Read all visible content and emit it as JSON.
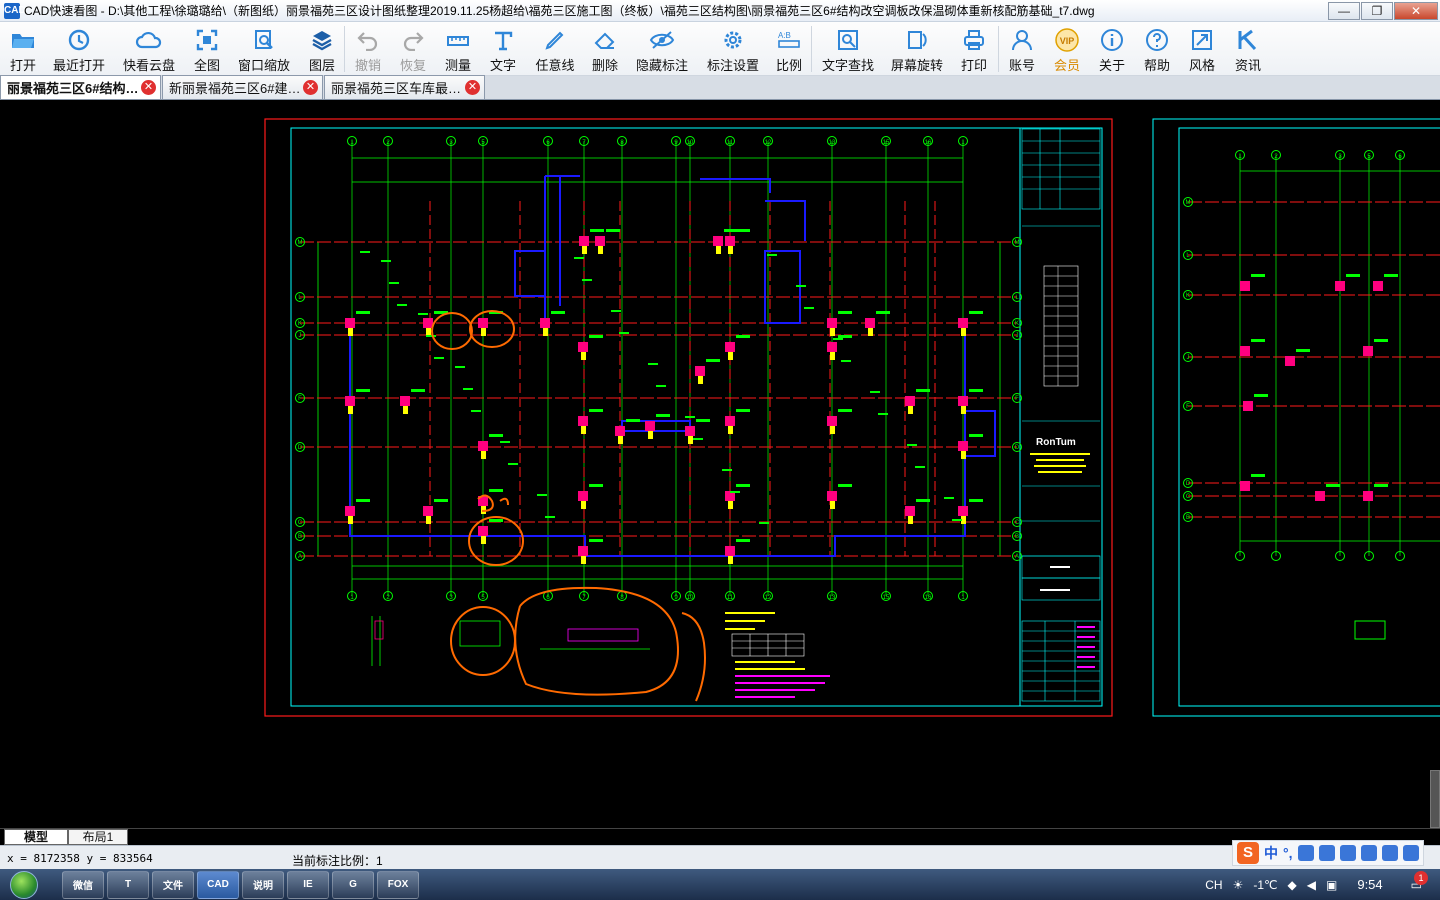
{
  "window": {
    "title": "CAD快速看图 - D:\\其他工程\\徐璐璐给\\（新图纸）丽景福苑三区设计图纸整理2019.11.25杨超给\\福苑三区施工图（终板）\\福苑三区结构图\\丽景福苑三区6#结构改空调板改保温砌体重新核配筋基础_t7.dwg",
    "app_icon": "CAD",
    "minimize": "—",
    "maximize": "❐",
    "close": "✕"
  },
  "toolbar": {
    "items": [
      {
        "label": "打开",
        "icon": "folder-open-icon",
        "enabled": true
      },
      {
        "label": "最近打开",
        "icon": "history-icon",
        "enabled": true
      },
      {
        "label": "快看云盘",
        "icon": "cloud-icon",
        "enabled": true
      },
      {
        "label": "全图",
        "icon": "fit-all-icon",
        "enabled": true
      },
      {
        "label": "窗口缩放",
        "icon": "window-zoom-icon",
        "enabled": true
      },
      {
        "label": "图层",
        "icon": "layers-icon",
        "enabled": true
      },
      {
        "label": "撤销",
        "icon": "undo-icon",
        "enabled": false
      },
      {
        "label": "恢复",
        "icon": "redo-icon",
        "enabled": false
      },
      {
        "label": "测量",
        "icon": "measure-icon",
        "enabled": true
      },
      {
        "label": "文字",
        "icon": "text-icon",
        "enabled": true
      },
      {
        "label": "任意线",
        "icon": "pen-icon",
        "enabled": true
      },
      {
        "label": "删除",
        "icon": "eraser-icon",
        "enabled": true
      },
      {
        "label": "隐藏标注",
        "icon": "eye-hide-icon",
        "enabled": true
      },
      {
        "label": "标注设置",
        "icon": "gear-icon",
        "enabled": true
      },
      {
        "label": "比例",
        "icon": "scale-icon",
        "enabled": true
      },
      {
        "label": "文字查找",
        "icon": "text-search-icon",
        "enabled": true
      },
      {
        "label": "屏幕旋转",
        "icon": "rotate-icon",
        "enabled": true
      },
      {
        "label": "打印",
        "icon": "printer-icon",
        "enabled": true
      },
      {
        "label": "账号",
        "icon": "user-icon",
        "enabled": true
      },
      {
        "label": "会员",
        "icon": "vip-icon",
        "enabled": true
      },
      {
        "label": "关于",
        "icon": "info-icon",
        "enabled": true
      },
      {
        "label": "帮助",
        "icon": "help-icon",
        "enabled": true
      },
      {
        "label": "风格",
        "icon": "style-icon",
        "enabled": true
      },
      {
        "label": "资讯",
        "icon": "news-icon",
        "enabled": true
      }
    ],
    "vip_badge": "VIP"
  },
  "tabs": [
    {
      "label": "丽景福苑三区6#结构…",
      "active": true
    },
    {
      "label": "新丽景福苑三区6#建…",
      "active": false
    },
    {
      "label": "丽景福苑三区车库最…",
      "active": false
    }
  ],
  "tab_close_glyph": "✕",
  "layouts": {
    "model": "模型",
    "layout1": "布局1"
  },
  "status": {
    "coords": "x = 8172358  y = 833564",
    "scale_text": "当前标注比例：1"
  },
  "drawing": {
    "axis_letters_left": [
      "M",
      "L",
      "K",
      "J",
      "F",
      "D",
      "C",
      "B",
      "A"
    ],
    "axis_numbers_top": [
      "1",
      "2",
      "3",
      "5",
      "6",
      "7",
      "8",
      "9",
      "10",
      "11",
      "12",
      "13",
      "15",
      "16"
    ],
    "right_axis_letters": [
      "M",
      "L",
      "K",
      "J",
      "F",
      "D",
      "C",
      "B",
      "A"
    ],
    "right_axis_numbers": [
      "1",
      "2",
      "3",
      "5",
      "6"
    ],
    "titleblock_logo": "RonTum"
  },
  "ime": {
    "zh": "中",
    "punct": "°,"
  },
  "taskbar": {
    "apps": [
      "微信",
      "T",
      "文件",
      "CAD",
      "说明",
      "IE",
      "G",
      "FOX"
    ],
    "tray_lang": "CH",
    "temp": "-1℃",
    "time": "9:54",
    "notif": "1"
  },
  "colors": {
    "canvas_bg": "#000000",
    "frame_red": "#ff1a1a",
    "border_cyan": "#00ffff",
    "axis_green": "#00ff00",
    "wall_blue": "#1a1aff",
    "column_magenta": "#ff007f",
    "annot_orange": "#ff6a00",
    "yellow": "#ffff00"
  }
}
